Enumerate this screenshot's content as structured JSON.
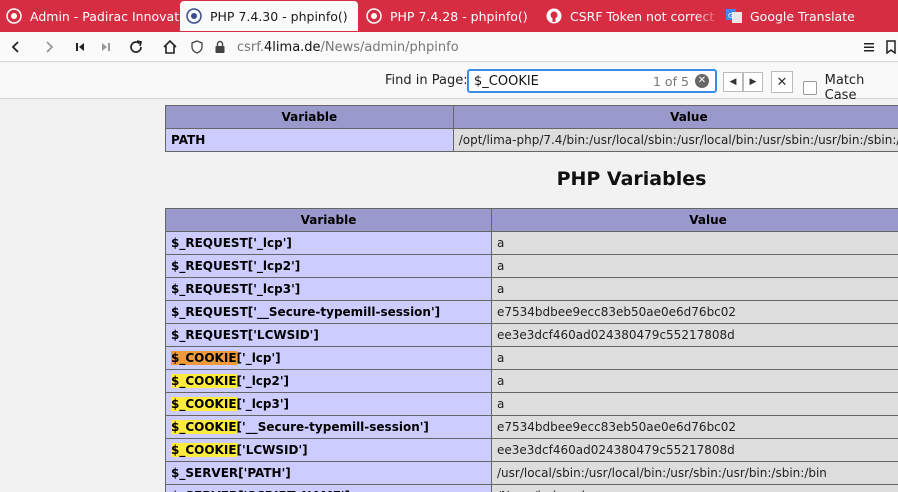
{
  "tabs": [
    {
      "label": "Admin - Padirac Innovation",
      "active": false
    },
    {
      "label": "PHP 7.4.30 - phpinfo()",
      "active": true
    },
    {
      "label": "PHP 7.4.28 - phpinfo()",
      "active": false
    },
    {
      "label": "CSRF Token not correct - a",
      "active": false
    },
    {
      "label": "Google Translate",
      "active": false
    }
  ],
  "url": {
    "prefix": "csrf.",
    "domain": "4lima.de",
    "path": "/News/admin/phpinfo"
  },
  "find": {
    "label": "Find in Page:",
    "value": "$_COOKIE",
    "count": "1 of 5",
    "match_case": "Match Case"
  },
  "env_table": {
    "headers": [
      "Variable",
      "Value"
    ],
    "rows": [
      {
        "var": "PATH",
        "val": "/opt/lima-php/7.4/bin:/usr/local/sbin:/usr/local/bin:/usr/sbin:/usr/bin:/sbin:/bin"
      }
    ]
  },
  "php_vars": {
    "title": "PHP Variables",
    "headers": [
      "Variable",
      "Value"
    ],
    "rows": [
      {
        "hl": "",
        "rest": "$_REQUEST['_lcp']",
        "val": "a"
      },
      {
        "hl": "",
        "rest": "$_REQUEST['_lcp2']",
        "val": "a"
      },
      {
        "hl": "",
        "rest": "$_REQUEST['_lcp3']",
        "val": "a"
      },
      {
        "hl": "",
        "rest": "$_REQUEST['__Secure-typemill-session']",
        "val": "e7534bdbee9ecc83eb50ae0e6d76bc02"
      },
      {
        "hl": "",
        "rest": "$_REQUEST['LCWSID']",
        "val": "ee3e3dcf460ad024380479c55217808d"
      },
      {
        "hl": "$_COOKIE",
        "rest": "['_lcp']",
        "val": "a",
        "current": true
      },
      {
        "hl": "$_COOKIE",
        "rest": "['_lcp2']",
        "val": "a"
      },
      {
        "hl": "$_COOKIE",
        "rest": "['_lcp3']",
        "val": "a"
      },
      {
        "hl": "$_COOKIE",
        "rest": "['__Secure-typemill-session']",
        "val": "e7534bdbee9ecc83eb50ae0e6d76bc02"
      },
      {
        "hl": "$_COOKIE",
        "rest": "['LCWSID']",
        "val": "ee3e3dcf460ad024380479c55217808d"
      },
      {
        "hl": "",
        "rest": "$_SERVER['PATH']",
        "val": "/usr/local/sbin:/usr/local/bin:/usr/sbin:/usr/bin:/sbin:/bin"
      },
      {
        "hl": "",
        "rest": "$_SERVER['SCRIPT_NAME']",
        "val": "/News/index.php"
      }
    ]
  },
  "colors": {
    "tabstrip": "#d62d43",
    "table_header": "#9999cc",
    "table_key": "#ccccff",
    "table_value": "#dddddd",
    "highlight": "#ffeb3b",
    "highlight_current": "#ef9a3a"
  }
}
